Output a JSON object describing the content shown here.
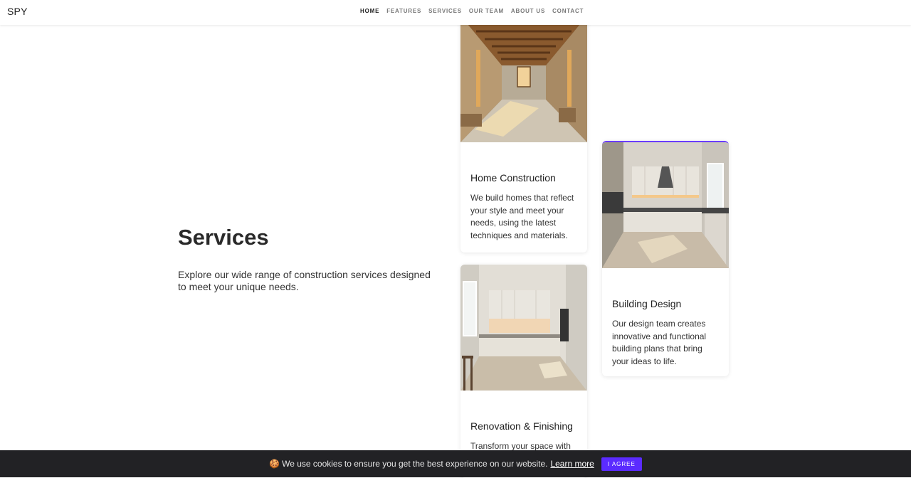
{
  "nav": {
    "brand": "SPY",
    "items": [
      "HOME",
      "FEATURES",
      "SERVICES",
      "OUR TEAM",
      "ABOUT US",
      "CONTACT"
    ],
    "active": "HOME"
  },
  "hero": {
    "title": "Services",
    "subtitle": "Explore our wide range of construction services designed to meet your unique needs."
  },
  "cards": [
    {
      "title": "Home Construction",
      "text": "We build homes that reflect your style and meet your needs, using the latest techniques and materials.",
      "image": "construction-interior"
    },
    {
      "title": "Building Design",
      "text": "Our design team creates innovative and functional building plans that bring your ideas to life.",
      "image": "kitchen-modern"
    },
    {
      "title": "Renovation & Finishing",
      "text": "Transform your space with",
      "image": "kitchen-renovated"
    }
  ],
  "cookie": {
    "icon": "cookie-icon",
    "message": "We use cookies to ensure you get the best experience on our website.",
    "link": "Learn more",
    "button": "I AGREE"
  },
  "colors": {
    "accent": "#5b2bff",
    "cookie_bg": "#222225"
  }
}
